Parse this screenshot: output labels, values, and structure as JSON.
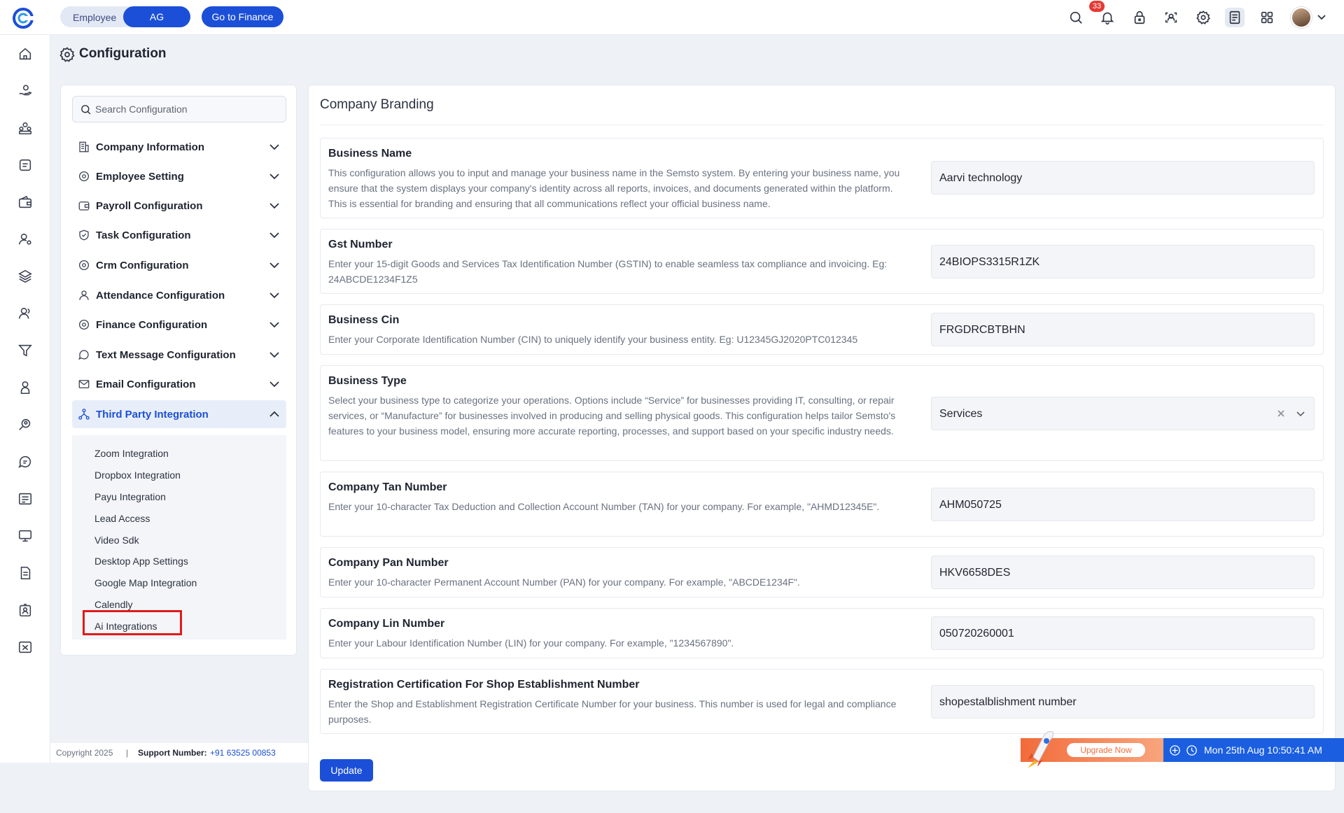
{
  "topbar": {
    "mode_toggle": {
      "employee": "Employee",
      "ag": "AG"
    },
    "finance_button": "Go to Finance",
    "notification_count": "33",
    "icons": [
      "search-icon",
      "bell-icon",
      "lock-icon",
      "face-scan-icon",
      "gear-icon",
      "notes-icon",
      "apps-grid-icon",
      "avatar",
      "chevron-down-icon"
    ]
  },
  "rail": {
    "icons": [
      "home-icon",
      "hand-money-icon",
      "team-icon",
      "checklist-icon",
      "wallet-icon",
      "user-settings-icon",
      "layers-icon",
      "user-group-icon",
      "filter-icon",
      "person-icon",
      "search-person-icon",
      "chat-icon",
      "list-card-icon",
      "monitor-icon",
      "document-icon",
      "id-card-icon",
      "crossed-box-icon"
    ]
  },
  "page": {
    "title": "Configuration"
  },
  "config_panel": {
    "search_placeholder": "Search Configuration",
    "menu": [
      {
        "label": "Company Information",
        "icon": "building-icon"
      },
      {
        "label": "Employee Setting",
        "icon": "gear-icon"
      },
      {
        "label": "Payroll Configuration",
        "icon": "wallet-icon"
      },
      {
        "label": "Task Configuration",
        "icon": "shield-check-icon"
      },
      {
        "label": "Crm Configuration",
        "icon": "gear-icon"
      },
      {
        "label": "Attendance Configuration",
        "icon": "person-icon"
      },
      {
        "label": "Finance Configuration",
        "icon": "gear-icon"
      },
      {
        "label": "Text Message Configuration",
        "icon": "message-icon"
      },
      {
        "label": "Email Configuration",
        "icon": "mail-icon"
      },
      {
        "label": "Third Party Integration",
        "icon": "network-icon",
        "expanded": true
      }
    ],
    "submenu": [
      "Zoom Integration",
      "Dropbox Integration",
      "Payu Integration",
      "Lead Access",
      "Video Sdk",
      "Desktop App Settings",
      "Google Map Integration",
      "Calendly",
      "Ai Integrations"
    ],
    "highlighted_submenu_item": "Ai Integrations"
  },
  "content": {
    "section_title": "Company Branding",
    "fields": [
      {
        "label": "Business Name",
        "description": "This configuration allows you to input and manage your business name in the Semsto system. By entering your business name, you ensure that the system displays your company's identity across all reports, invoices, and documents generated within the platform. This is essential for branding and ensuring that all communications reflect your official business name.",
        "value": "Aarvi technology"
      },
      {
        "label": "Gst Number",
        "description": "Enter your 15-digit Goods and Services Tax Identification Number (GSTIN) to enable seamless tax compliance and invoicing. Eg: 24ABCDE1234F1Z5",
        "value": "24BIOPS3315R1ZK"
      },
      {
        "label": "Business Cin",
        "description": "Enter your Corporate Identification Number (CIN) to uniquely identify your business entity. Eg: U12345GJ2020PTC012345",
        "value": "FRGDRCBTBHN"
      },
      {
        "label": "Business Type",
        "description": "Select your business type to categorize your operations. Options include “Service” for businesses providing IT, consulting, or repair services, or “Manufacture” for businesses involved in producing and selling physical goods. This configuration helps tailor Semsto's features to your business model, ensuring more accurate reporting, processes, and support based on your specific industry needs.",
        "value": "Services"
      },
      {
        "label": "Company Tan Number",
        "description": "Enter your 10-character Tax Deduction and Collection Account Number (TAN) for your company. For example, \"AHMD12345E\".",
        "value": "AHM050725"
      },
      {
        "label": "Company Pan Number",
        "description": "Enter your 10-character Permanent Account Number (PAN) for your company. For example, \"ABCDE1234F\".",
        "value": "HKV6658DES"
      },
      {
        "label": "Company Lin Number",
        "description": "Enter your Labour Identification Number (LIN) for your company. For example, \"1234567890\".",
        "value": "050720260001"
      },
      {
        "label": "Registration Certification For Shop Establishment Number",
        "description": "Enter the Shop and Establishment Registration Certificate Number for your business. This number is used for legal and compliance purposes.",
        "value": "shopestalblishment number"
      }
    ],
    "update_button": "Update"
  },
  "footer": {
    "copyright": "Copyright 2025",
    "separator": "|",
    "support_label": "Support Number:",
    "support_number": "+91 63525 00853",
    "upgrade_label": "Upgrade Now",
    "datetime": "Mon 25th Aug 10:50:41 AM"
  },
  "colors": {
    "accent": "#1b4fd8",
    "highlight_border": "#e01b1b",
    "upgrade_orange": "#f26b3a",
    "badge_red": "#e53935"
  }
}
